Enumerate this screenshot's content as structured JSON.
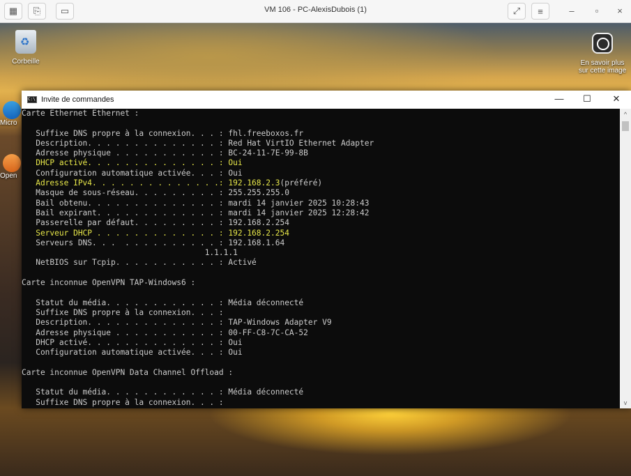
{
  "vm_bar": {
    "title": "VM 106 - PC-AlexisDubois (1)",
    "left_buttons": [
      "display-icon",
      "clipboard-icon",
      "monitor-icon"
    ],
    "expand_icon": "⤢",
    "menu_icon": "≡",
    "minimize": "–",
    "restore": "▫",
    "close": "×"
  },
  "desktop": {
    "recycle_bin_label": "Corbeille",
    "learn_more_label": "En savoir plus sur cette image",
    "side_icon_1_label": "Micro",
    "side_icon_2_label": "Open"
  },
  "cmd": {
    "title": "Invite de commandes",
    "icon_text": "C:\\",
    "minimize": "—",
    "maximize": "☐",
    "close": "✕",
    "lines": [
      {
        "lbl": "Carte Ethernet Ethernet :",
        "val": "",
        "hl": false
      },
      {
        "lbl": "",
        "val": "",
        "hl": false
      },
      {
        "lbl": "   Suffixe DNS propre à la connexion. . . : ",
        "val": "fhl.freeboxos.fr",
        "hl": false
      },
      {
        "lbl": "   Description. . . . . . . . . . . . . . : ",
        "val": "Red Hat VirtIO Ethernet Adapter",
        "hl": false
      },
      {
        "lbl": "   Adresse physique . . . . . . . . . . . : ",
        "val": "BC-24-11-7E-99-8B",
        "hl": false
      },
      {
        "lbl": "   DHCP activé. . . . . . . . . . . . . . : ",
        "val": "Oui",
        "hl": true
      },
      {
        "lbl": "   Configuration automatique activée. . . : ",
        "val": "Oui",
        "hl": false
      },
      {
        "lbl": "   Adresse IPv4. . . . . . . . . . . . . .: ",
        "val": "192.168.2.3",
        "val2": "(préféré)",
        "hl": true
      },
      {
        "lbl": "   Masque de sous-réseau. . . . . . . . . : ",
        "val": "255.255.255.0",
        "hl": false
      },
      {
        "lbl": "   Bail obtenu. . . . . . . . . . . . . . : ",
        "val": "mardi 14 janvier 2025 10:28:43",
        "hl": false
      },
      {
        "lbl": "   Bail expirant. . . . . . . . . . . . . : ",
        "val": "mardi 14 janvier 2025 12:28:42",
        "hl": false
      },
      {
        "lbl": "   Passerelle par défaut. . . . . . . . . : ",
        "val": "192.168.2.254",
        "hl": false
      },
      {
        "lbl": "   Serveur DHCP . . . . . . . . . . . . . : ",
        "val": "192.168.2.254",
        "hl": true
      },
      {
        "lbl": "   Serveurs DNS. . .  . . . . . . . . . . : ",
        "val": "192.168.1.64",
        "hl": false
      },
      {
        "lbl": "                                       ",
        "val": "1.1.1.1",
        "hl": false
      },
      {
        "lbl": "   NetBIOS sur Tcpip. . . . . . . . . . . : ",
        "val": "Activé",
        "hl": false
      },
      {
        "lbl": "",
        "val": "",
        "hl": false
      },
      {
        "lbl": "Carte inconnue OpenVPN TAP-Windows6 :",
        "val": "",
        "hl": false
      },
      {
        "lbl": "",
        "val": "",
        "hl": false
      },
      {
        "lbl": "   Statut du média. . . . . . . . . . . . : ",
        "val": "Média déconnecté",
        "hl": false
      },
      {
        "lbl": "   Suffixe DNS propre à la connexion. . . : ",
        "val": "",
        "hl": false
      },
      {
        "lbl": "   Description. . . . . . . . . . . . . . : ",
        "val": "TAP-Windows Adapter V9",
        "hl": false
      },
      {
        "lbl": "   Adresse physique . . . . . . . . . . . : ",
        "val": "00-FF-C8-7C-CA-52",
        "hl": false
      },
      {
        "lbl": "   DHCP activé. . . . . . . . . . . . . . : ",
        "val": "Oui",
        "hl": false
      },
      {
        "lbl": "   Configuration automatique activée. . . : ",
        "val": "Oui",
        "hl": false
      },
      {
        "lbl": "",
        "val": "",
        "hl": false
      },
      {
        "lbl": "Carte inconnue OpenVPN Data Channel Offload :",
        "val": "",
        "hl": false
      },
      {
        "lbl": "",
        "val": "",
        "hl": false
      },
      {
        "lbl": "   Statut du média. . . . . . . . . . . . : ",
        "val": "Média déconnecté",
        "hl": false
      },
      {
        "lbl": "   Suffixe DNS propre à la connexion. . . : ",
        "val": "",
        "hl": false
      }
    ]
  },
  "colors": {
    "console_bg": "#0c0c0c",
    "console_text": "#cccccc",
    "highlight_text": "#e8e84a"
  }
}
